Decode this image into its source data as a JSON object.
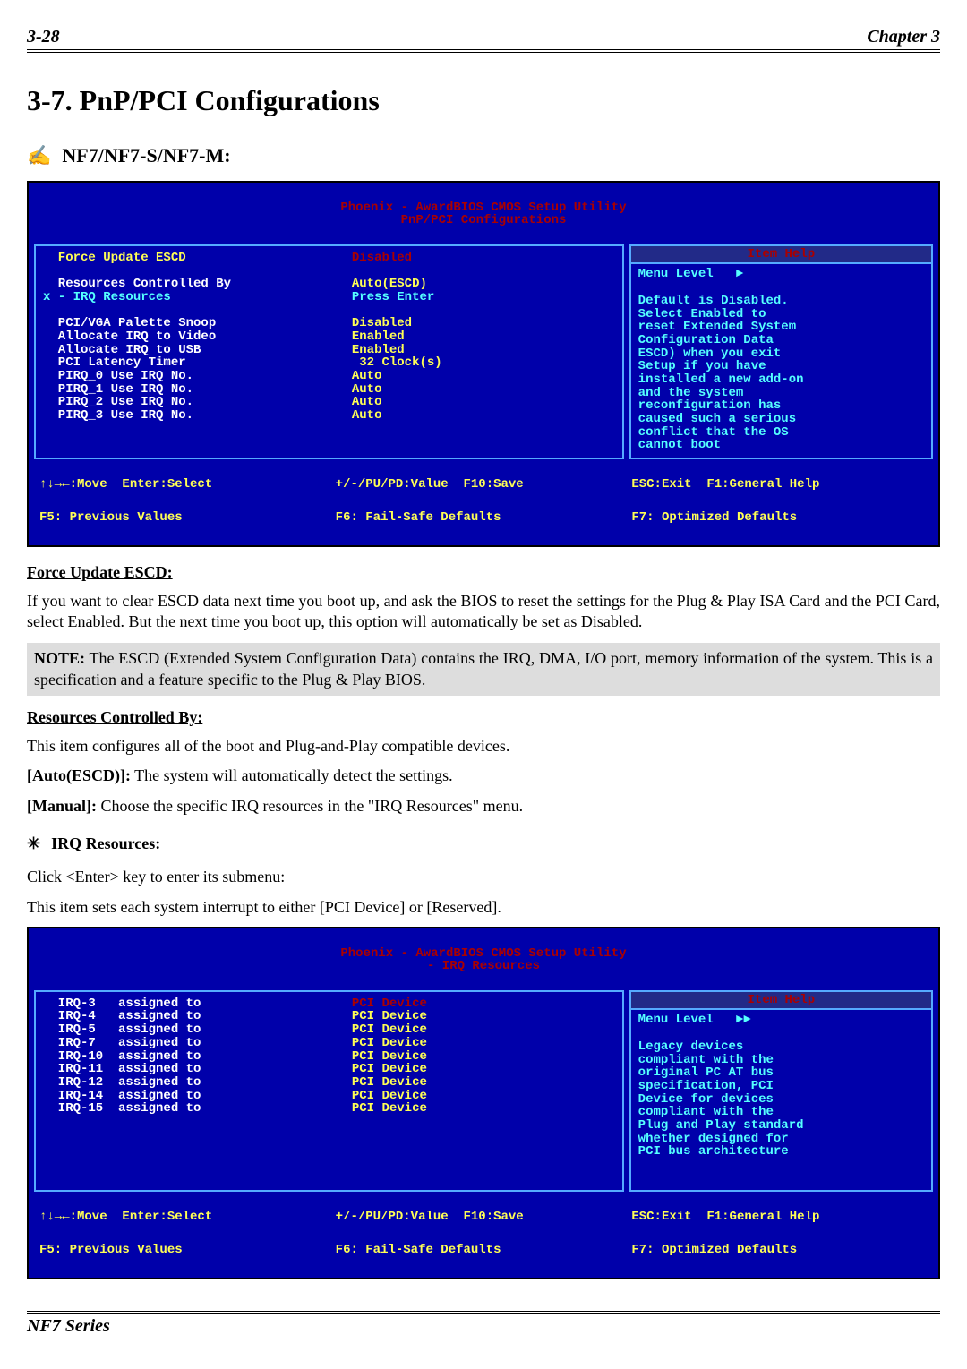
{
  "hdr": {
    "left": "3-28",
    "right": "Chapter 3"
  },
  "title": "3-7.  PnP/PCI Configurations",
  "model": "NF7/NF7-S/NF7-M:",
  "bios1": {
    "banner1": "Phoenix - AwardBIOS CMOS Setup Utility",
    "banner2": "PnP/PCI Configurations",
    "left": [
      "  Force Update ESCD",
      "",
      "  Resources Controlled By",
      "x - IRQ Resources",
      "",
      "  PCI/VGA Palette Snoop",
      "  Allocate IRQ to Video",
      "  Allocate IRQ to USB",
      "  PCI Latency Timer",
      "  PIRQ_0 Use IRQ No.",
      "  PIRQ_1 Use IRQ No.",
      "  PIRQ_2 Use IRQ No.",
      "  PIRQ_3 Use IRQ No."
    ],
    "right": [
      "Disabled",
      "",
      "Auto(ESCD)",
      "Press Enter",
      "",
      "Disabled",
      "Enabled",
      "Enabled",
      " 32 Clock(s)",
      "Auto",
      "Auto",
      "Auto",
      "Auto"
    ],
    "helpTitle": "Item Help",
    "help": [
      "Menu Level   ►",
      "",
      "Default is Disabled.",
      "Select Enabled to",
      "reset Extended System",
      "Configuration Data",
      "ESCD) when you exit",
      "Setup if you have",
      "installed a new add-on",
      "and the system",
      "reconfiguration has",
      "caused such a serious",
      "conflict that the OS",
      "cannot boot"
    ],
    "nav1a": "↑↓→←:Move  Enter:Select",
    "nav1b": "+/-/PU/PD:Value  F10:Save",
    "nav1c": "ESC:Exit  F1:General Help",
    "nav2a": "F5: Previous Values",
    "nav2b": "F6: Fail-Safe Defaults",
    "nav2c": "F7: Optimized Defaults"
  },
  "sec1": {
    "h": "Force Update ESCD:",
    "p": "If you want to clear ESCD data next time you boot up, and ask the BIOS to reset the settings for the Plug & Play ISA Card and the PCI Card, select Enabled. But the next time you boot up, this option will automatically be set as Disabled."
  },
  "note": {
    "label": "NOTE:",
    "text": " The ESCD (Extended System Configuration Data) contains the IRQ, DMA, I/O port, memory information of the system. This is a specification and a feature specific to the Plug & Play BIOS."
  },
  "sec2": {
    "h": "Resources Controlled By:",
    "p": "This item configures all of the boot and Plug-and-Play compatible devices.",
    "auto_l": "[Auto(ESCD)]:",
    "auto_t": " The system will automatically detect the settings.",
    "man_l": "[Manual]:",
    "man_t": " Choose the specific IRQ resources in the \"IRQ Resources\" menu."
  },
  "sec3": {
    "h": "IRQ Resources:",
    "p1": "Click <Enter> key to enter its submenu:",
    "p2": "This item sets each system interrupt to either [PCI Device] or [Reserved]."
  },
  "bios2": {
    "banner1": "Phoenix - AwardBIOS CMOS Setup Utility",
    "banner2": "- IRQ Resources",
    "left": [
      "  IRQ-3   assigned to",
      "  IRQ-4   assigned to",
      "  IRQ-5   assigned to",
      "  IRQ-7   assigned to",
      "  IRQ-10  assigned to",
      "  IRQ-11  assigned to",
      "  IRQ-12  assigned to",
      "  IRQ-14  assigned to",
      "  IRQ-15  assigned to",
      " ",
      " ",
      " ",
      " "
    ],
    "right": [
      "PCI Device",
      "PCI Device",
      "PCI Device",
      "PCI Device",
      "PCI Device",
      "PCI Device",
      "PCI Device",
      "PCI Device",
      "PCI Device",
      " ",
      " ",
      " ",
      " "
    ],
    "helpTitle": "Item Help",
    "help": [
      "Menu Level   ►►",
      "",
      "Legacy devices",
      "compliant with the",
      "original PC AT bus",
      "specification, PCI",
      "Device for devices",
      "compliant with the",
      "Plug and Play standard",
      "whether designed for",
      "PCI bus architecture",
      " ",
      " "
    ],
    "nav1a": "↑↓→←:Move  Enter:Select",
    "nav1b": "+/-/PU/PD:Value  F10:Save",
    "nav1c": "ESC:Exit  F1:General Help",
    "nav2a": "F5: Previous Values",
    "nav2b": "F6: Fail-Safe Defaults",
    "nav2c": "F7: Optimized Defaults"
  },
  "ftr": "NF7 Series"
}
